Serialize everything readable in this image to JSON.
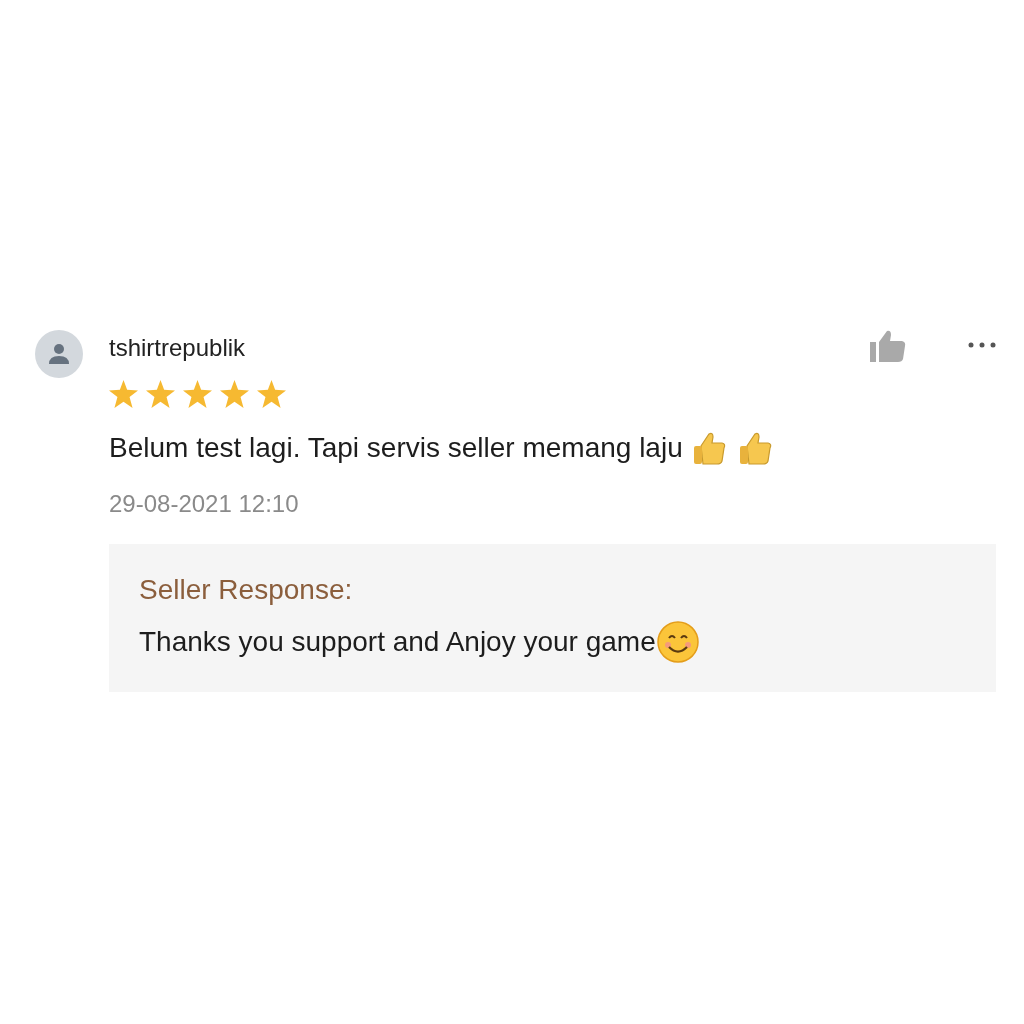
{
  "review": {
    "username": "tshirtrepublik",
    "stars": 5,
    "comment": "Belum test lagi. Tapi servis seller memang laju",
    "comment_emojis": [
      {
        "kind": "thumbs_up"
      },
      {
        "kind": "thumbs_up"
      }
    ],
    "date": "29-08-2021 12:10"
  },
  "seller_response": {
    "label": "Seller Response:",
    "text": "Thanks you support and Anjoy your game",
    "emojis": [
      {
        "kind": "smiling"
      }
    ]
  }
}
